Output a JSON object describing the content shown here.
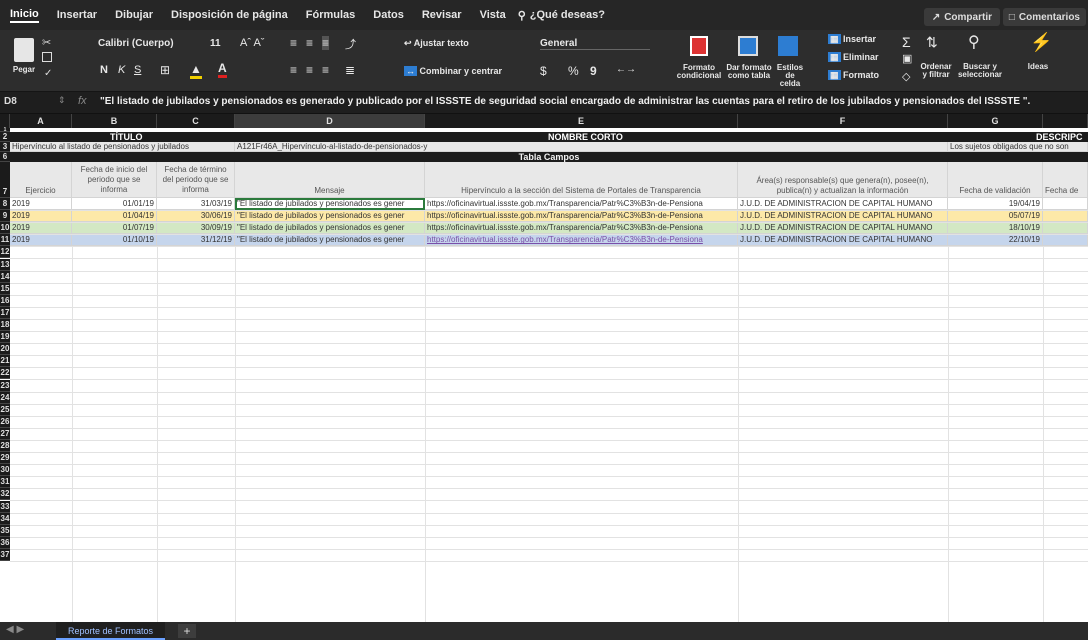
{
  "ribbon_tabs": [
    "Inicio",
    "Insertar",
    "Dibujar",
    "Disposición de página",
    "Fórmulas",
    "Datos",
    "Revisar",
    "Vista"
  ],
  "tell_me": "¿Qué deseas?",
  "share_label": "Compartir",
  "comments_label": "Comentarios",
  "ribbon": {
    "paste": "Pegar",
    "font_name": "Calibri (Cuerpo)",
    "font_size": "11",
    "bold": "N",
    "italic": "K",
    "underline": "S",
    "wrap_text": "Ajustar texto",
    "merge_center": "Combinar y centrar",
    "number_format": "General",
    "currency": "$",
    "percent": "%",
    "comma": "9",
    "cond_format": "Formato condicional",
    "table_format": "Dar formato como tabla",
    "cell_styles": "Estilos de celda",
    "insert": "Insertar",
    "delete": "Eliminar",
    "format": "Formato",
    "sort_filter": "Ordenar y filtrar",
    "find_select": "Buscar y seleccionar",
    "ideas": "Ideas"
  },
  "formula_bar": {
    "name_box": "D8",
    "fx": "fx",
    "content": "\"El listado de jubilados y pensionados es generado y publicado por el ISSSTE de seguridad social encargado de administrar las cuentas para el retiro de los jubilados y pensionados del ISSSTE \"."
  },
  "columns": [
    "A",
    "B",
    "C",
    "D",
    "E",
    "F",
    "G"
  ],
  "row2": {
    "titulo": "TÍTULO",
    "nombre_corto": "NOMBRE CORTO",
    "descripcion": "DESCRIPC"
  },
  "row3": {
    "titulo": "Hipervínculo al listado de pensionados y jubilados",
    "nombre_corto": "A121Fr46A_Hipervínculo-al-listado-de-pensionados-y",
    "descripcion": "Los sujetos obligados que no son"
  },
  "tabla_campos": "Tabla Campos",
  "headers": [
    "Ejercicio",
    "Fecha de inicio del periodo que se informa",
    "Fecha de término del periodo que se informa",
    "Mensaje",
    "Hipervínculo a la sección del Sistema de Portales de Transparencia",
    "Área(s) responsable(s) que genera(n), posee(n), publica(n) y actualizan la información",
    "Fecha de validación",
    "Fecha de"
  ],
  "rows": [
    {
      "ejercicio": "2019",
      "inicio": "01/01/19",
      "termino": "31/03/19",
      "mensaje": "\"El listado de jubilados y pensionados es gener",
      "hipervinculo": "https://oficinavirtual.issste.gob.mx/Transparencia/Patr%C3%B3n-de-Pensiona",
      "area": "J.U.D. DE ADMINISTRACION DE CAPITAL HUMANO",
      "validacion": "19/04/19",
      "color": "#ffffff"
    },
    {
      "ejercicio": "2019",
      "inicio": "01/04/19",
      "termino": "30/06/19",
      "mensaje": "\"El listado de jubilados y pensionados es gener",
      "hipervinculo": "https://oficinavirtual.issste.gob.mx/Transparencia/Patr%C3%B3n-de-Pensiona",
      "area": "J.U.D. DE ADMINISTRACION DE CAPITAL HUMANO",
      "validacion": "05/07/19",
      "color": "#fde9a8"
    },
    {
      "ejercicio": "2019",
      "inicio": "01/07/19",
      "termino": "30/09/19",
      "mensaje": "\"El listado de jubilados y pensionados es gener",
      "hipervinculo": "https://oficinavirtual.issste.gob.mx/Transparencia/Patr%C3%B3n-de-Pensiona",
      "area": "J.U.D. DE ADMINISTRACION DE CAPITAL HUMANO",
      "validacion": "18/10/19",
      "color": "#d3e8c4"
    },
    {
      "ejercicio": "2019",
      "inicio": "01/10/19",
      "termino": "31/12/19",
      "mensaje": "\"El listado de jubilados y pensionados es gener",
      "hipervinculo": "https://oficinavirtual.issste.gob.mx/Transparencia/Patr%C3%B3n-de-Pensiona",
      "area": "J.U.D. DE ADMINISTRACION DE CAPITAL HUMANO",
      "validacion": "22/10/19",
      "color": "#c5d5ec"
    }
  ],
  "row_numbers": [
    "1",
    "2",
    "3",
    "6",
    "7",
    "8",
    "9",
    "10",
    "11",
    "12",
    "13",
    "14",
    "15",
    "16",
    "17",
    "18",
    "19",
    "20",
    "21",
    "22",
    "23",
    "24",
    "25",
    "26",
    "27",
    "28",
    "29",
    "30",
    "31",
    "32",
    "33",
    "34",
    "35",
    "36",
    "37"
  ],
  "sheet_tab": "Reporte de Formatos",
  "add_sheet": "+"
}
